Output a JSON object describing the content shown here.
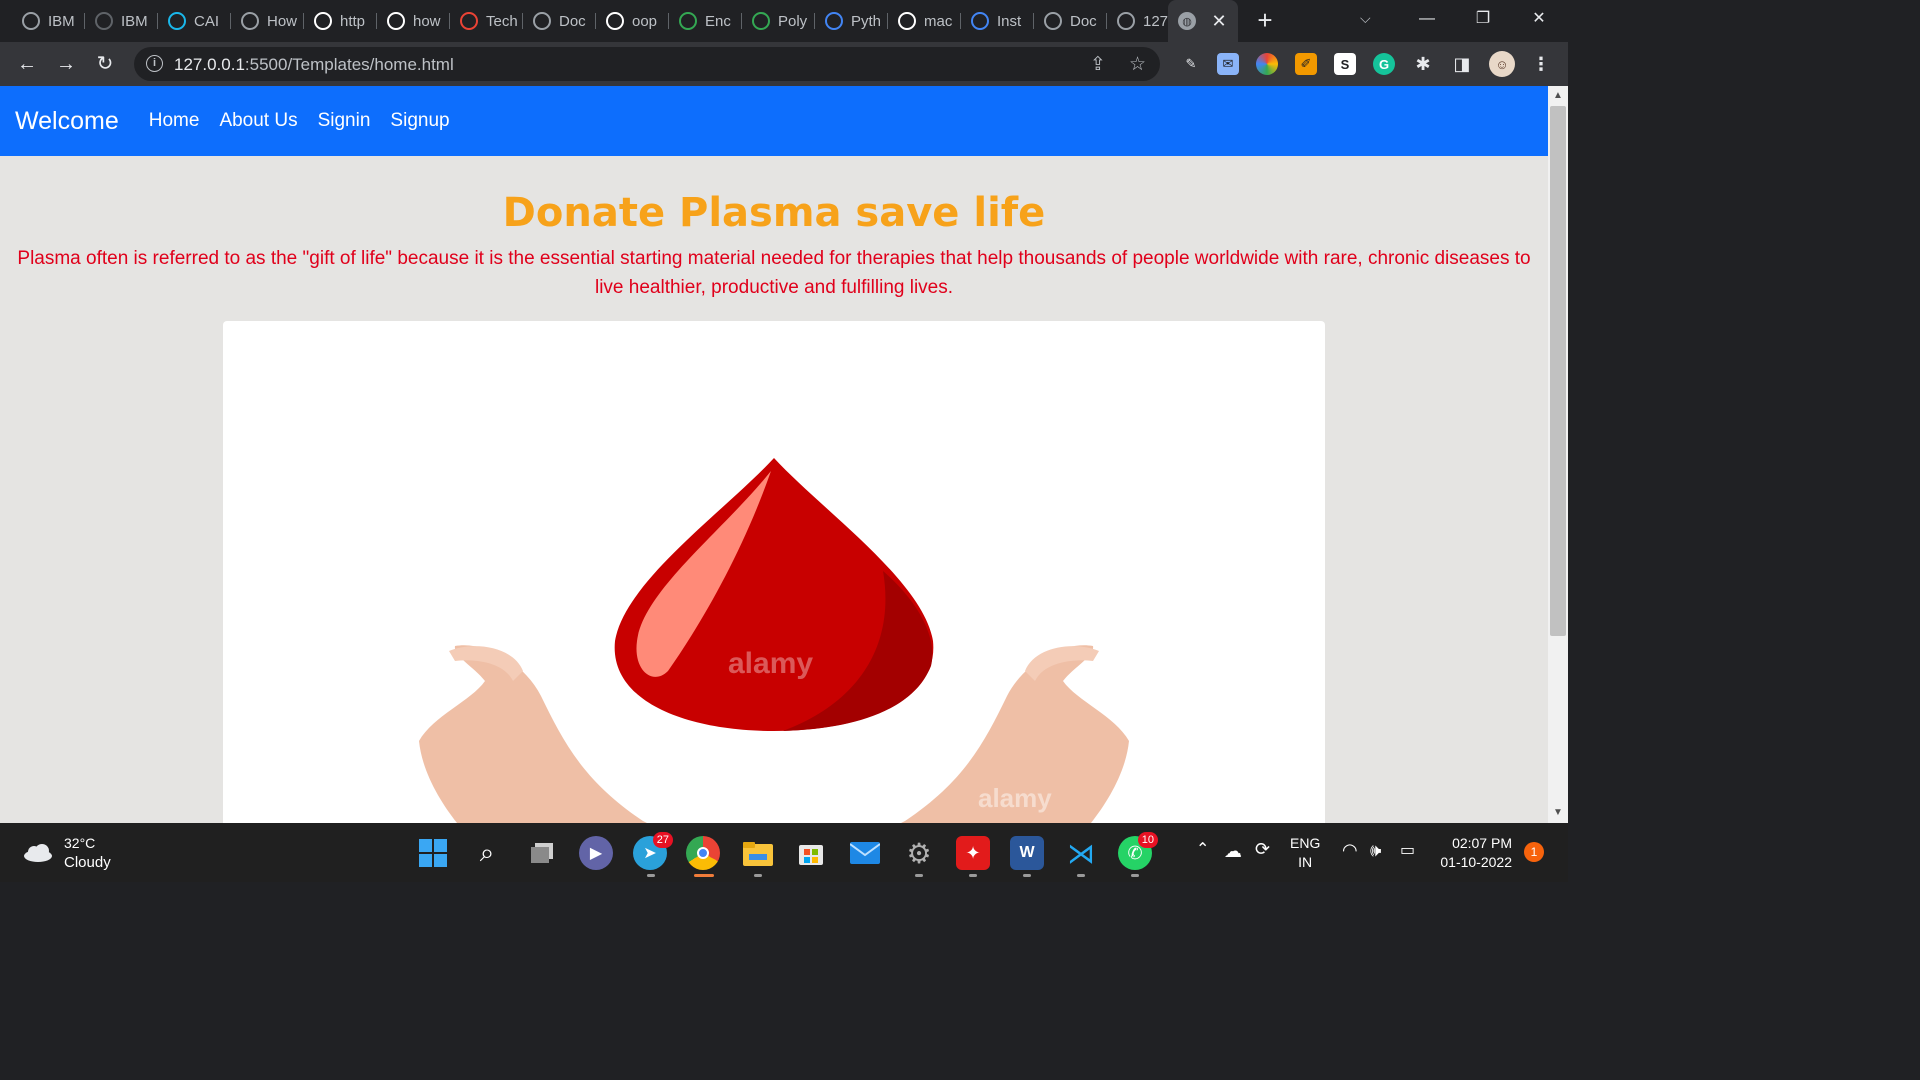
{
  "browser": {
    "tabs": [
      {
        "label": "IBM",
        "icon": "globe-icon",
        "color": "#9aa0a6"
      },
      {
        "label": "IBM",
        "icon": "github-icon",
        "color": "#5f6368"
      },
      {
        "label": "CAI",
        "icon": "vimeo-icon",
        "color": "#1ab7ea"
      },
      {
        "label": "How",
        "icon": "link-icon",
        "color": "#9aa0a6"
      },
      {
        "label": "http",
        "icon": "google-icon",
        "color": "#ffffff"
      },
      {
        "label": "how",
        "icon": "google-icon",
        "color": "#ffffff"
      },
      {
        "label": "Tech",
        "icon": "gmail-icon",
        "color": "#ea4335"
      },
      {
        "label": "Doc",
        "icon": "globe-icon",
        "color": "#9aa0a6"
      },
      {
        "label": "oop",
        "icon": "google-icon",
        "color": "#ffffff"
      },
      {
        "label": "Enc",
        "icon": "infinity-icon",
        "color": "#34a853"
      },
      {
        "label": "Poly",
        "icon": "b-icon",
        "color": "#34a853"
      },
      {
        "label": "Pyth",
        "icon": "g-icon",
        "color": "#4285f4"
      },
      {
        "label": "mac",
        "icon": "google-icon",
        "color": "#ffffff"
      },
      {
        "label": "Inst",
        "icon": "world-icon",
        "color": "#4285f4"
      },
      {
        "label": "Doc",
        "icon": "globe-icon",
        "color": "#9aa0a6"
      },
      {
        "label": "127",
        "icon": "globe-icon",
        "color": "#9aa0a6"
      }
    ],
    "active_tab": {
      "label": "",
      "icon": "globe-icon"
    },
    "url_host": "127.0.0.1",
    "url_path": ":5500/Templates/home.html"
  },
  "site": {
    "brand": "Welcome",
    "nav": [
      "Home",
      "About Us",
      "Signin",
      "Signup"
    ],
    "title": "Donate Plasma save life",
    "text": "Plasma often is referred to as the \"gift of life\" because it is the essential starting material needed for therapies that help thousands of people worldwide with rare, chronic diseases to live healthier, productive and fulfilling lives.",
    "watermark": "alamy",
    "colors": {
      "nav": "#0d6efd",
      "title": "#f7a21a",
      "text": "#e0001b",
      "drop": "#c80000"
    }
  },
  "taskbar": {
    "temperature": "32°C",
    "weather": "Cloudy",
    "telegram_badge": "27",
    "whatsapp_badge": "10",
    "lang_line1": "ENG",
    "lang_line2": "IN",
    "time": "02:07 PM",
    "date": "01-10-2022",
    "notifications": "1"
  }
}
